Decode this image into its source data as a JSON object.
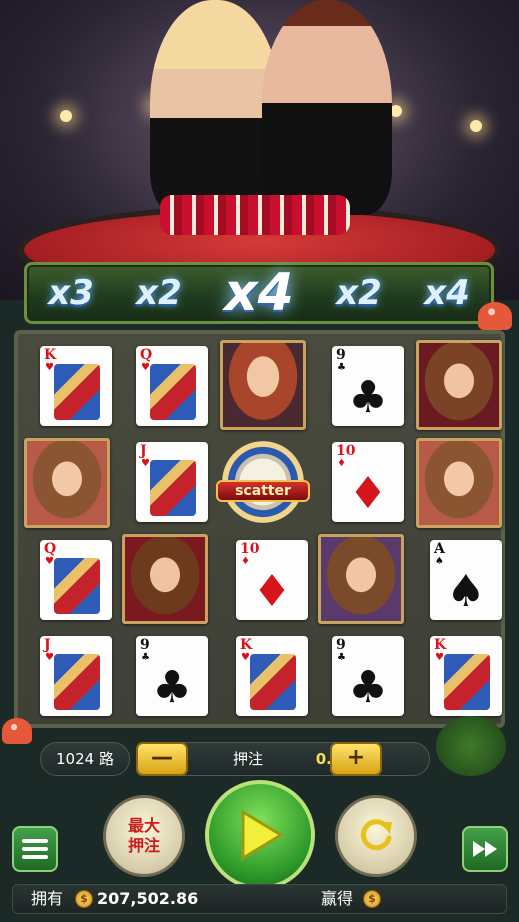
{
  "multipliers": {
    "values": [
      "x3",
      "x2",
      "x4",
      "x2",
      "x4"
    ],
    "active_index": 2
  },
  "reels": {
    "columns": [
      [
        {
          "type": "card",
          "rank": "K",
          "suit": "♥",
          "color": "red"
        },
        {
          "type": "photo",
          "variant": "p1"
        },
        {
          "type": "card",
          "rank": "Q",
          "suit": "♥",
          "color": "red"
        },
        {
          "type": "card",
          "rank": "J",
          "suit": "♥",
          "color": "red"
        }
      ]
    ]
  },
  "controls": {
    "ways_label": "1024 路",
    "bet_label": "押注",
    "bet_value": "0.5",
    "minus_symbol": "—",
    "plus_symbol": "+"
  },
  "buttons": {
    "max_bet_line1": "最大",
    "max_bet_line2": "押注"
  },
  "footer": {
    "balance_label": "拥有",
    "balance_value": "207,502.86",
    "win_label": "赢得",
    "coin_symbol": "$"
  },
  "symbols": {
    "scatter_label": "scatter"
  },
  "colors": {
    "multiplier_glow": "#6fb4ff",
    "bet_value": "#f5dc57",
    "button_gold": "#ffe36a",
    "spin_green": "#2f9a2a"
  }
}
